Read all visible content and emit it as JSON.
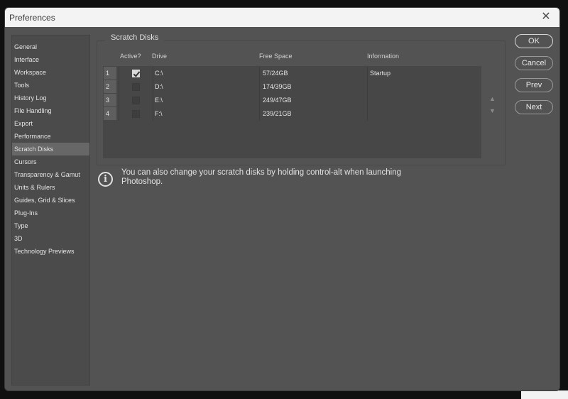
{
  "window": {
    "title": "Preferences"
  },
  "sidebar": {
    "items": [
      {
        "label": "General"
      },
      {
        "label": "Interface"
      },
      {
        "label": "Workspace"
      },
      {
        "label": "Tools"
      },
      {
        "label": "History Log"
      },
      {
        "label": "File Handling"
      },
      {
        "label": "Export"
      },
      {
        "label": "Performance"
      },
      {
        "label": "Scratch Disks"
      },
      {
        "label": "Cursors"
      },
      {
        "label": "Transparency & Gamut"
      },
      {
        "label": "Units & Rulers"
      },
      {
        "label": "Guides, Grid & Slices"
      },
      {
        "label": "Plug-Ins"
      },
      {
        "label": "Type"
      },
      {
        "label": "3D"
      },
      {
        "label": "Technology Previews"
      }
    ],
    "selected": "Scratch Disks"
  },
  "scratch": {
    "group_title": "Scratch Disks",
    "headers": {
      "active": "Active?",
      "drive": "Drive",
      "free": "Free Space",
      "info": "Information"
    },
    "rows": [
      {
        "num": "1",
        "active": true,
        "drive": "C:\\",
        "free": "57/24GB",
        "info": "Startup"
      },
      {
        "num": "2",
        "active": false,
        "drive": "D:\\",
        "free": "174/39GB",
        "info": ""
      },
      {
        "num": "3",
        "active": false,
        "drive": "E:\\",
        "free": "249/47GB",
        "info": ""
      },
      {
        "num": "4",
        "active": false,
        "drive": "F:\\",
        "free": "239/21GB",
        "info": ""
      }
    ],
    "info_text": "You can also change your scratch disks by holding control-alt when launching Photoshop."
  },
  "buttons": {
    "ok": "OK",
    "cancel": "Cancel",
    "prev": "Prev",
    "next": "Next"
  },
  "icons": {
    "close": "close-icon",
    "info": "info-icon",
    "up": "arrow-up-icon",
    "down": "arrow-down-icon"
  }
}
